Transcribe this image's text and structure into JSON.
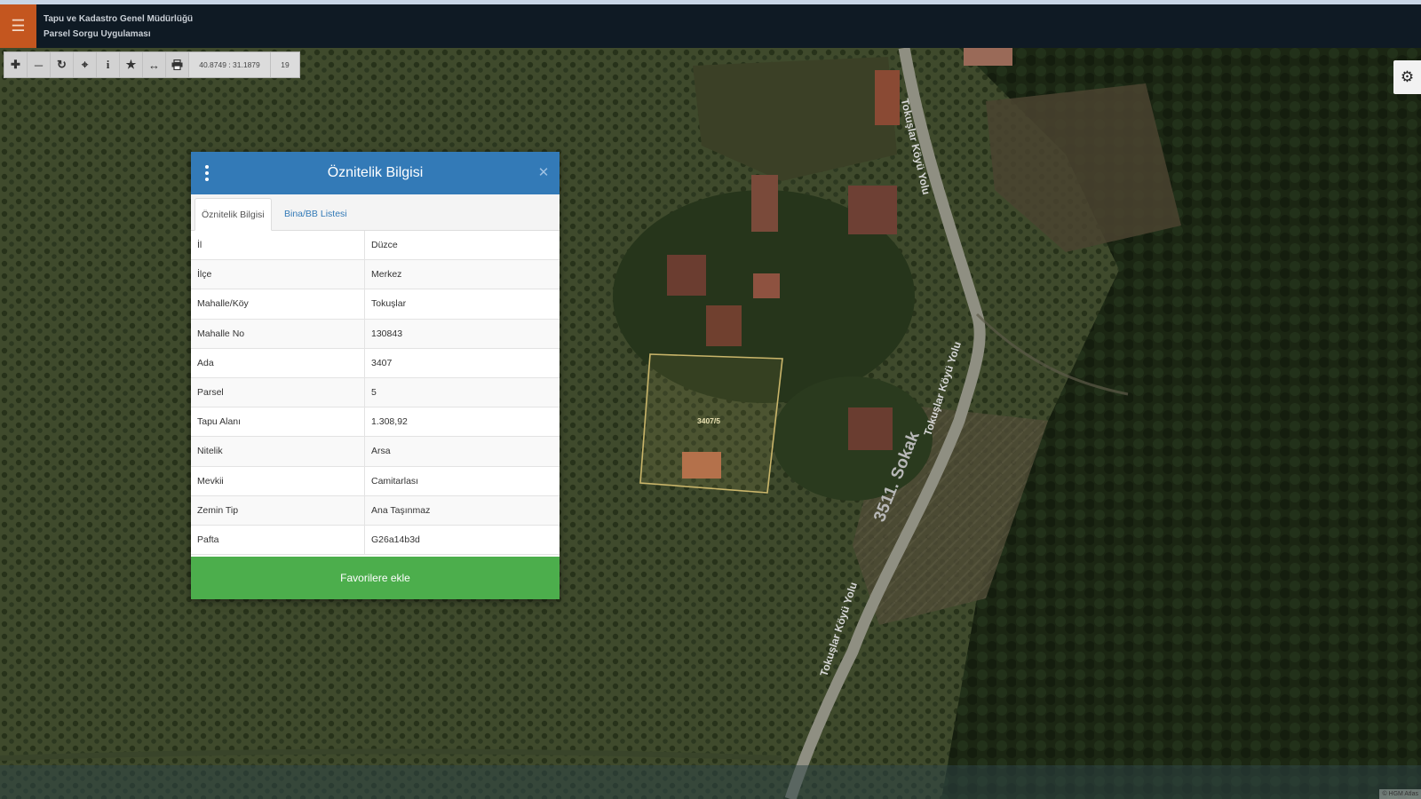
{
  "header": {
    "org": "Tapu ve Kadastro Genel Müdürlüğü",
    "app": "Parsel Sorgu Uygulaması",
    "menu_icon": "hamburger-icon"
  },
  "toolbar": {
    "tools": [
      "zoom-in-icon",
      "zoom-out-icon",
      "refresh-icon",
      "locate-icon",
      "info-icon",
      "favorite-star-icon",
      "measure-icon",
      "print-icon"
    ],
    "coordinates": "40.8749 : 31.1879",
    "zoom": "19"
  },
  "settings": {
    "icon": "gear-icon"
  },
  "dialog": {
    "title": "Öznitelik Bilgisi",
    "tabs": [
      {
        "label": "Öznitelik Bilgisi",
        "active": true
      },
      {
        "label": "Bina/BB Listesi",
        "active": false
      }
    ],
    "rows": [
      {
        "key": "İl",
        "value": "Düzce"
      },
      {
        "key": "İlçe",
        "value": "Merkez"
      },
      {
        "key": "Mahalle/Köy",
        "value": "Tokuşlar"
      },
      {
        "key": "Mahalle No",
        "value": "130843"
      },
      {
        "key": "Ada",
        "value": "3407"
      },
      {
        "key": "Parsel",
        "value": "5"
      },
      {
        "key": "Tapu Alanı",
        "value": "1.308,92"
      },
      {
        "key": "Nitelik",
        "value": "Arsa"
      },
      {
        "key": "Mevkii",
        "value": "Camitarlası"
      },
      {
        "key": "Zemin Tip",
        "value": "Ana Taşınmaz"
      },
      {
        "key": "Pafta",
        "value": "G26a14b3d"
      }
    ],
    "favorite_button": "Favorilere ekle"
  },
  "map": {
    "parcel_label": "3407/5",
    "road_labels": [
      "Tokuşlar Köyü Yolu",
      "3511. Sokak",
      "Tokuşlar Köyü Yolu",
      "Tokuşlar Köyü Yolu"
    ],
    "attribution": "© HGM Atlas",
    "colors": {
      "parcel_outline": "#c9b56a",
      "road": "#9a9a8c",
      "road_label": "#d6d6d6"
    }
  }
}
